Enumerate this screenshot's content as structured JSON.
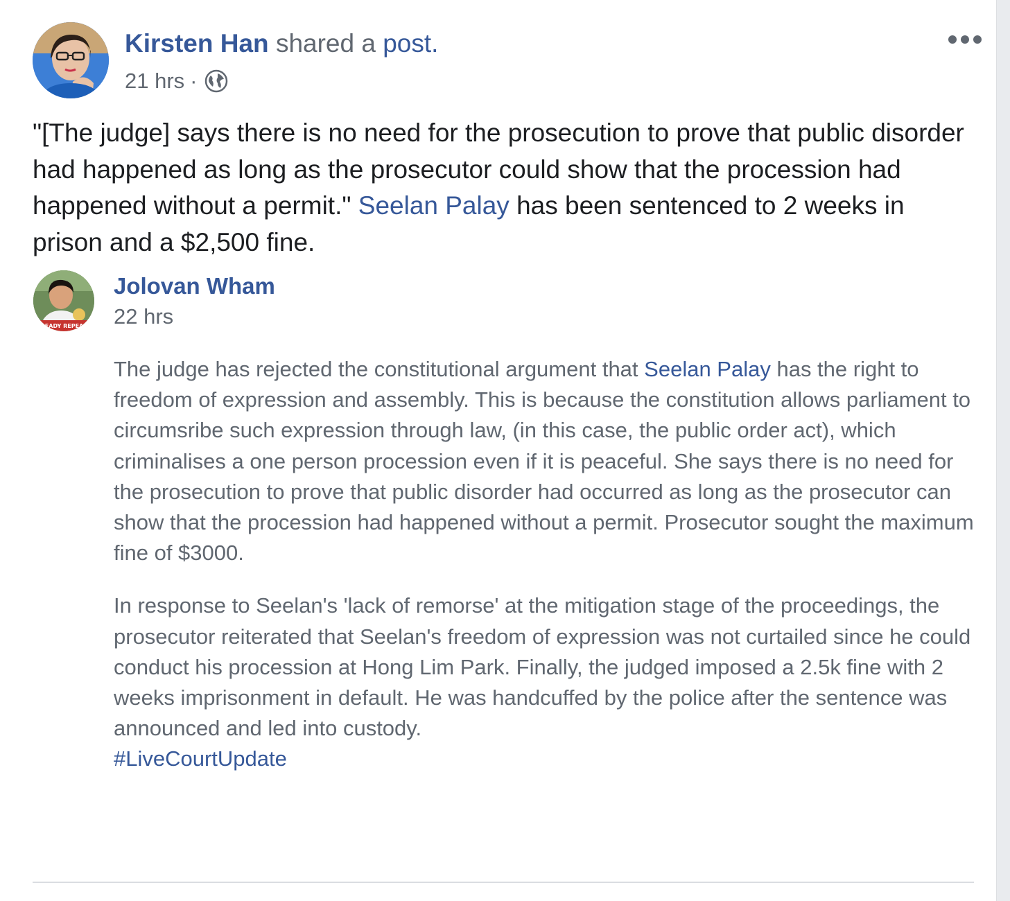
{
  "post": {
    "author": "Kirsten Han",
    "action_text": "shared a",
    "action_link": "post.",
    "time": "21 hrs",
    "separator": "·",
    "privacy_icon": "globe-icon",
    "menu_icon": "more-options-icon",
    "text_part1": "\"[The judge] says there is no need for the prosecution to prove that public disorder had happened as long as the prosecutor could show that the procession had happened without a permit.\" ",
    "text_mention": "Seelan Palay",
    "text_part2": " has been sentenced to 2 weeks in prison and a $2,500 fine."
  },
  "shared": {
    "author": "Jolovan Wham",
    "time": "22 hrs",
    "p1_part1": "The judge has rejected the constitutional argument that ",
    "p1_mention": "Seelan Palay",
    "p1_part2": " has the right to freedom of expression and assembly. This is because the constitution allows parliament to circumsribe such expression through law, (in this case, the public order act), which criminalises a one person procession even if it is peaceful. She says there is no need for the prosecution to prove that public disorder had occurred as long as the prosecutor can show that the procession had happened without a permit. Prosecutor sought the maximum fine of $3000.",
    "p2": "In response to Seelan's 'lack of remorse' at the mitigation stage of the proceedings, the prosecutor reiterated that Seelan's freedom of expression was not curtailed since he could conduct his procession at Hong Lim Park. Finally, the judged imposed a 2.5k fine with 2 weeks imprisonment in default. He was handcuffed by the police after the sentence was announced and led into custody.",
    "hashtag": "#LiveCourtUpdate",
    "avatar_banner": "READY REPEAL"
  },
  "colors": {
    "link": "#365899",
    "text": "#1c1e21",
    "muted": "#606770",
    "background": "#ffffff"
  }
}
